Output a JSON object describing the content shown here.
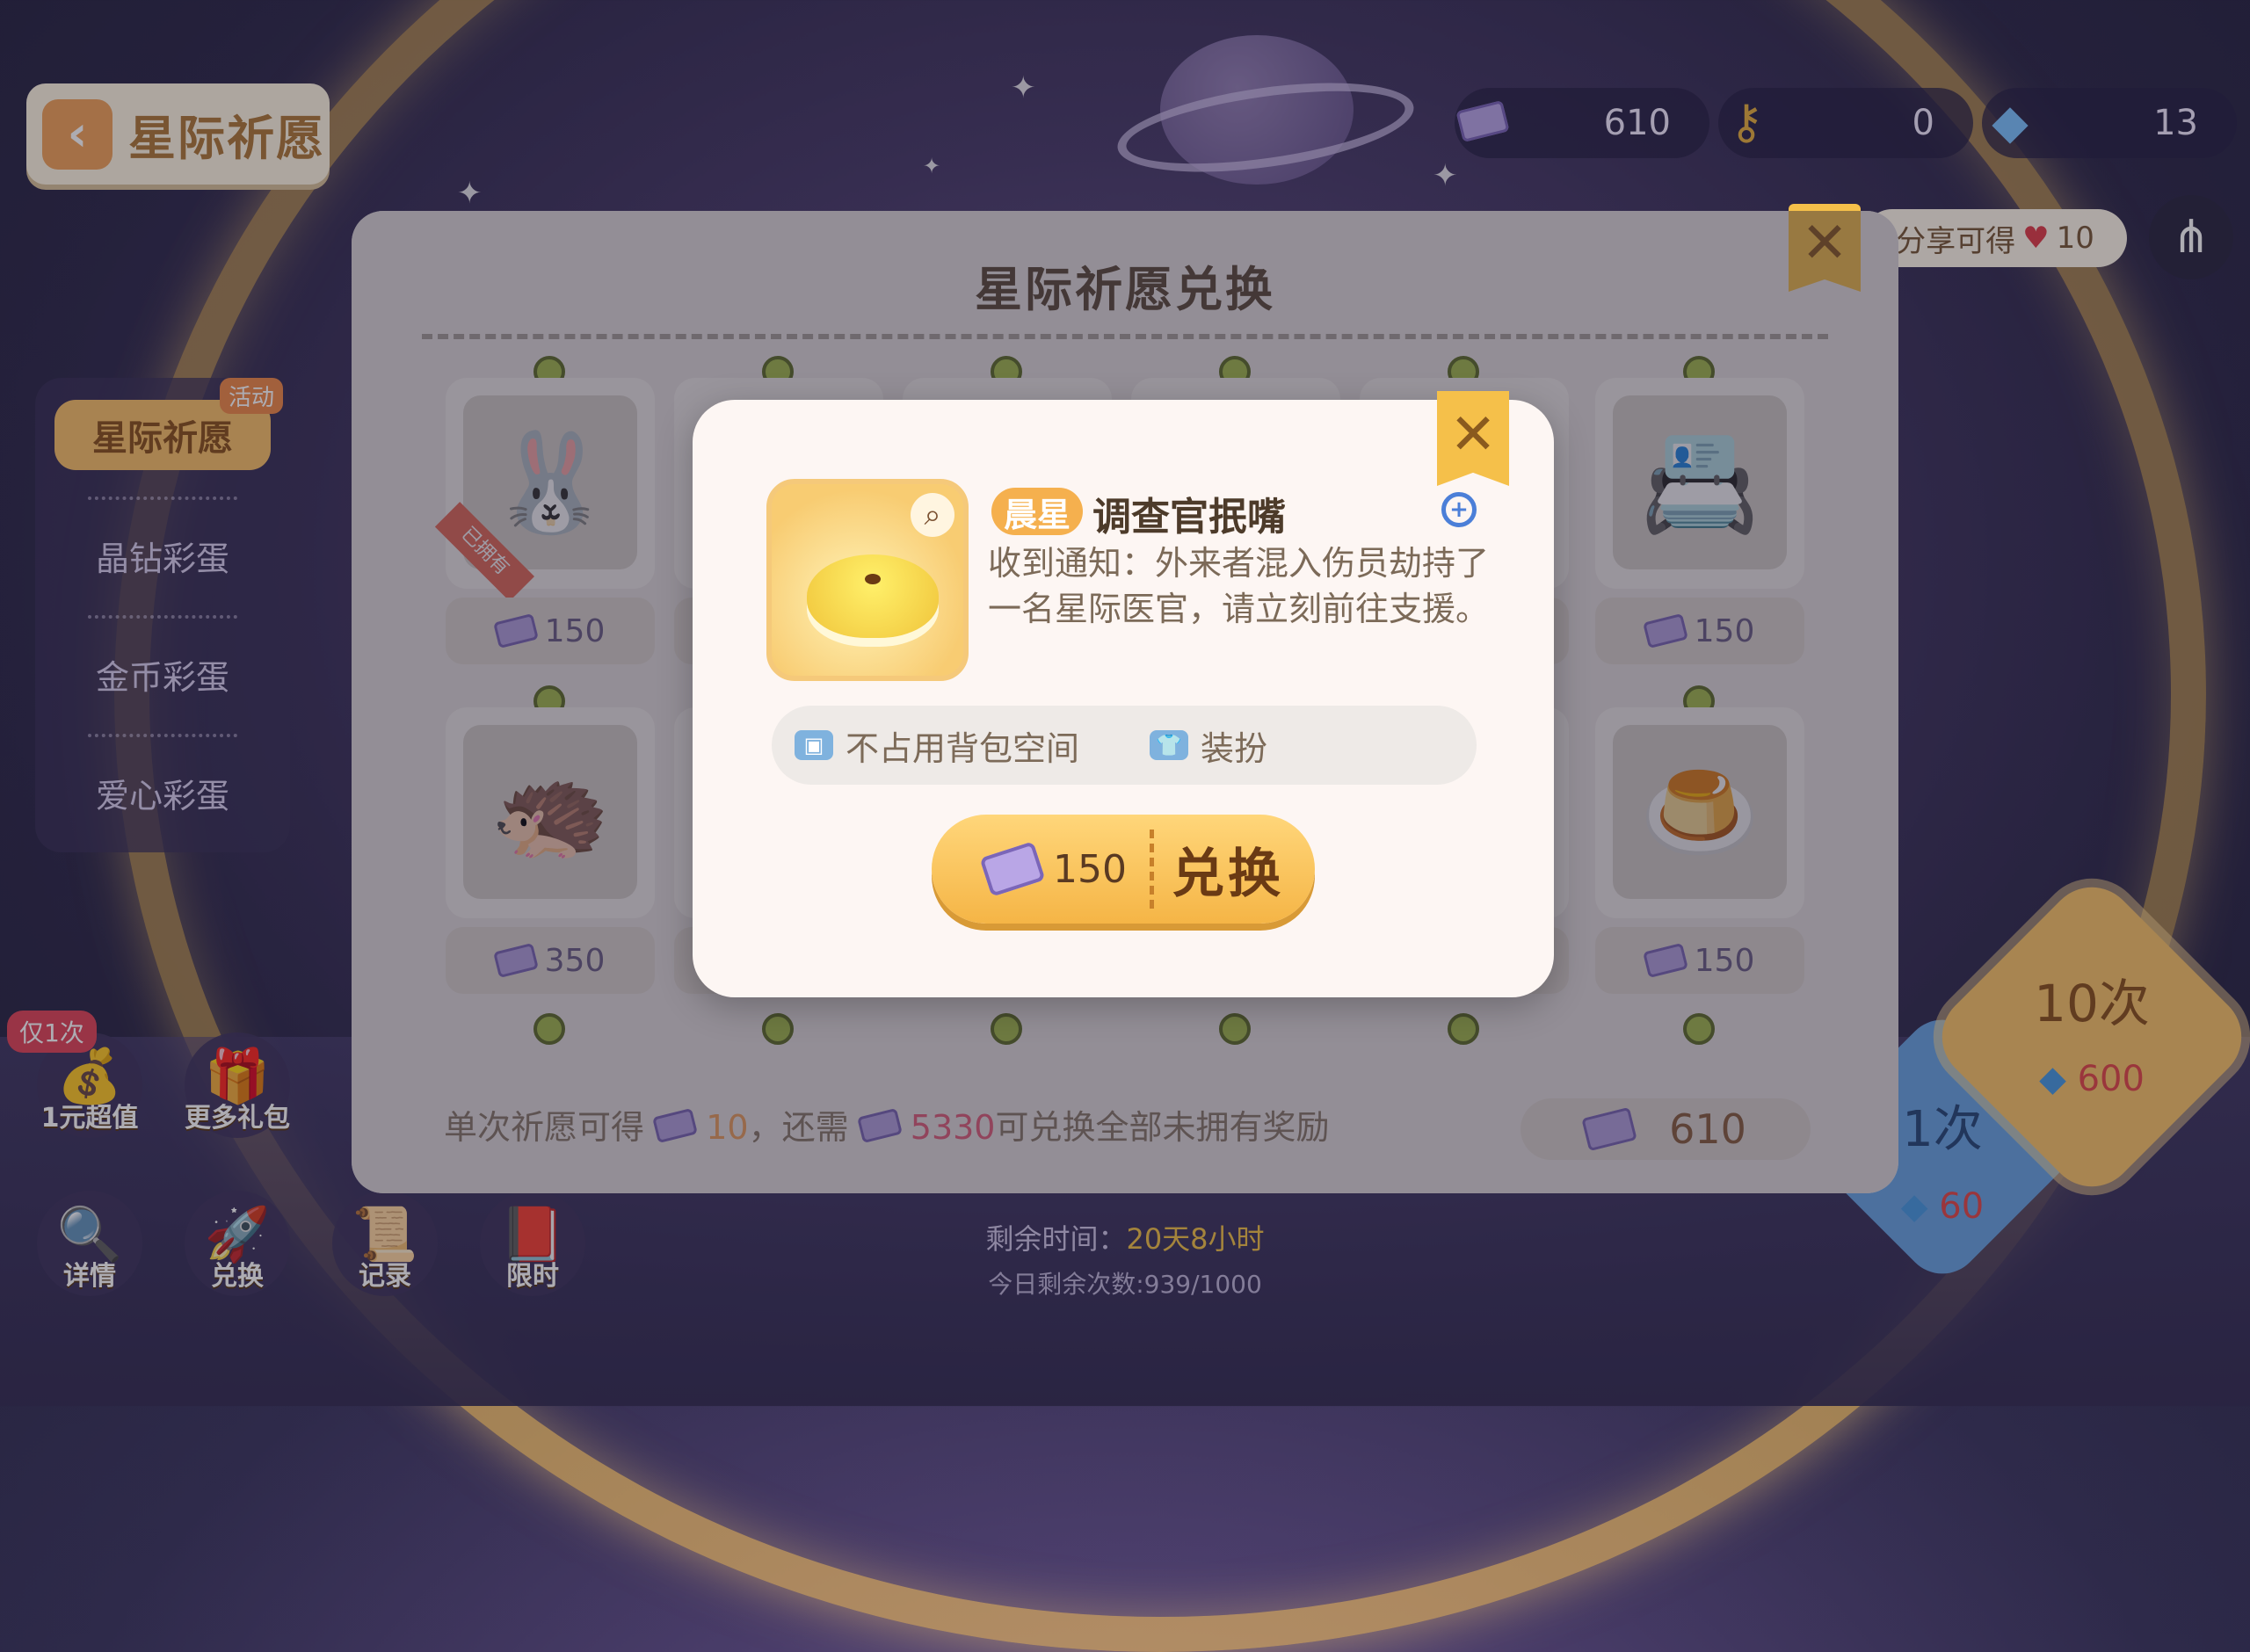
{
  "header": {
    "title": "星际祈愿",
    "back_icon": "back-arrow-icon"
  },
  "currencies": [
    {
      "icon": "wish-ticket-icon",
      "value": "610"
    },
    {
      "icon": "key-icon",
      "value": "0"
    },
    {
      "icon": "crystal-icon",
      "value": "13"
    }
  ],
  "share": {
    "tip": "分享可得",
    "reward": "10",
    "icon": "share-icon"
  },
  "sidebar": {
    "badge": "活动",
    "items": [
      {
        "label": "星际祈愿",
        "active": true
      },
      {
        "label": "晶钻彩蛋"
      },
      {
        "label": "金币彩蛋"
      },
      {
        "label": "爱心彩蛋"
      }
    ]
  },
  "left_buttons": {
    "only_once": "仅1次",
    "items": [
      {
        "label": "1元超值",
        "icon": "value-pack-icon"
      },
      {
        "label": "更多礼包",
        "icon": "gift-icon"
      },
      {
        "label": "详情",
        "icon": "magnifier-icon"
      },
      {
        "label": "兑换",
        "icon": "exchange-icon"
      },
      {
        "label": "记录",
        "icon": "scroll-icon"
      },
      {
        "label": "限时",
        "icon": "book-icon"
      }
    ]
  },
  "draw": {
    "ten_label": "10次",
    "ten_cost": "600",
    "one_label": "1次",
    "one_cost": "60"
  },
  "timer": {
    "remain_label": "剩余时间：",
    "remain_value": "20天8小时",
    "today_label": "今日剩余次数:939/1000"
  },
  "exchange_panel": {
    "title": "星际祈愿兑换",
    "owned_label": "已拥有",
    "cards": [
      {
        "price": "150",
        "art": "hood-item",
        "owned": true
      },
      {
        "price": "150",
        "art": "card-item"
      },
      {
        "price": "350",
        "art": "hair-item"
      },
      {
        "price": "150",
        "art": "pudding-item"
      }
    ],
    "footer": {
      "prefix": "单次祈愿可得",
      "gain": "10",
      "mid": "，还需",
      "need": "5330",
      "suffix": "可兑换全部未拥有奖励",
      "balance": "610"
    }
  },
  "item_popup": {
    "rarity": "晨星",
    "name": "调查官抿嘴",
    "description": "收到通知：外来者混入伤员劫持了一名星际医官，请立刻前往支援。",
    "tag_bag": "不占用背包空间",
    "tag_type": "装扮",
    "cost": "150",
    "exchange_label": "兑换",
    "colors": {
      "accent": "#f5b04e",
      "button": "#f5b546"
    }
  }
}
